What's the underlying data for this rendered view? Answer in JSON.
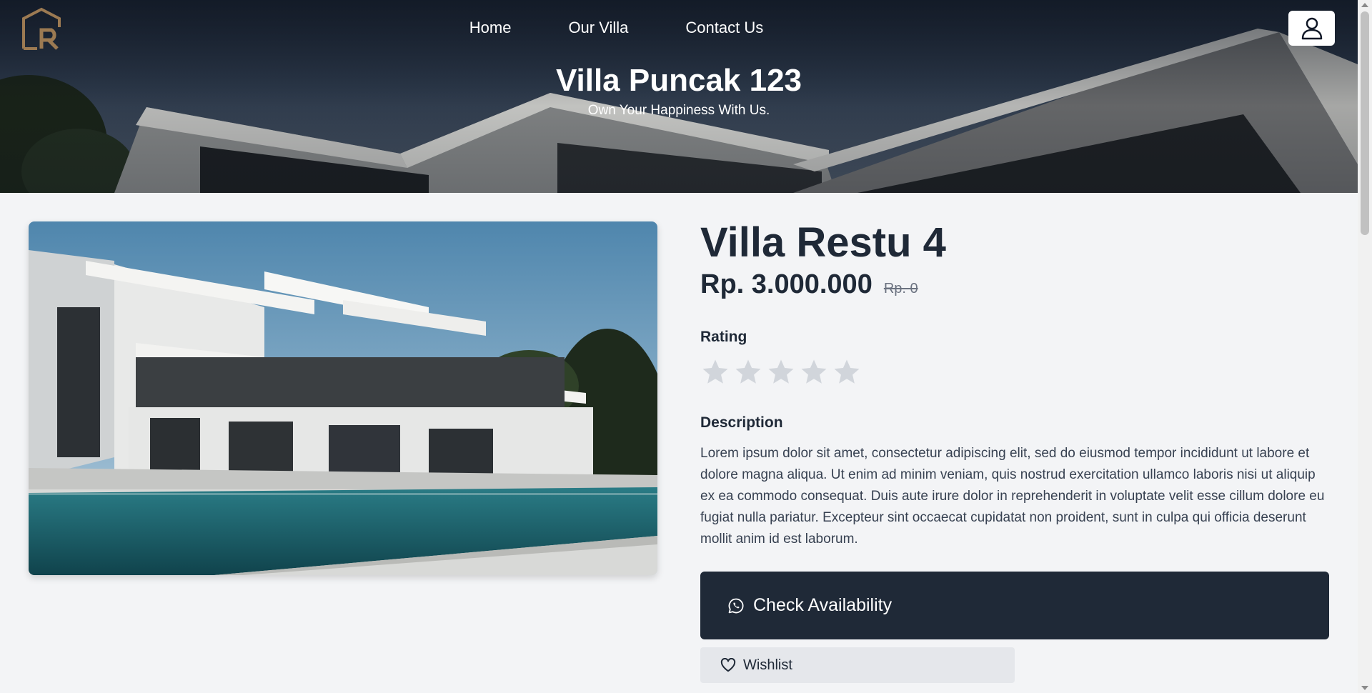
{
  "colors": {
    "primary_dark": "#1f2937",
    "logo_gold": "#9c7a52",
    "star_empty": "#d1d5db",
    "page_bg": "#f3f4f6"
  },
  "header": {
    "logo_icon": "villa-logo-icon",
    "nav": [
      {
        "label": "Home"
      },
      {
        "label": "Our Villa"
      },
      {
        "label": "Contact Us"
      }
    ],
    "profile_icon": "user-icon",
    "title": "Villa Puncak 123",
    "subtitle": "Own Your Happiness With Us."
  },
  "villa": {
    "name": "Villa Restu 4",
    "price": "Rp. 3.000.000",
    "old_price": "Rp. 0",
    "rating_label": "Rating",
    "rating_value": 0,
    "rating_max": 5,
    "description_label": "Description",
    "description": "Lorem ipsum dolor sit amet, consectetur adipiscing elit, sed do eiusmod tempor incididunt ut labore et dolore magna aliqua. Ut enim ad minim veniam, quis nostrud exercitation ullamco laboris nisi ut aliquip ex ea commodo consequat. Duis aute irure dolor in reprehenderit in voluptate velit esse cillum dolore eu fugiat nulla pariatur. Excepteur sint occaecat cupidatat non proident, sunt in culpa qui officia deserunt mollit anim id est laborum."
  },
  "actions": {
    "check_availability": "Check Availability",
    "check_icon": "whatsapp-icon",
    "wishlist": "Wishlist",
    "wishlist_icon": "heart-icon"
  }
}
